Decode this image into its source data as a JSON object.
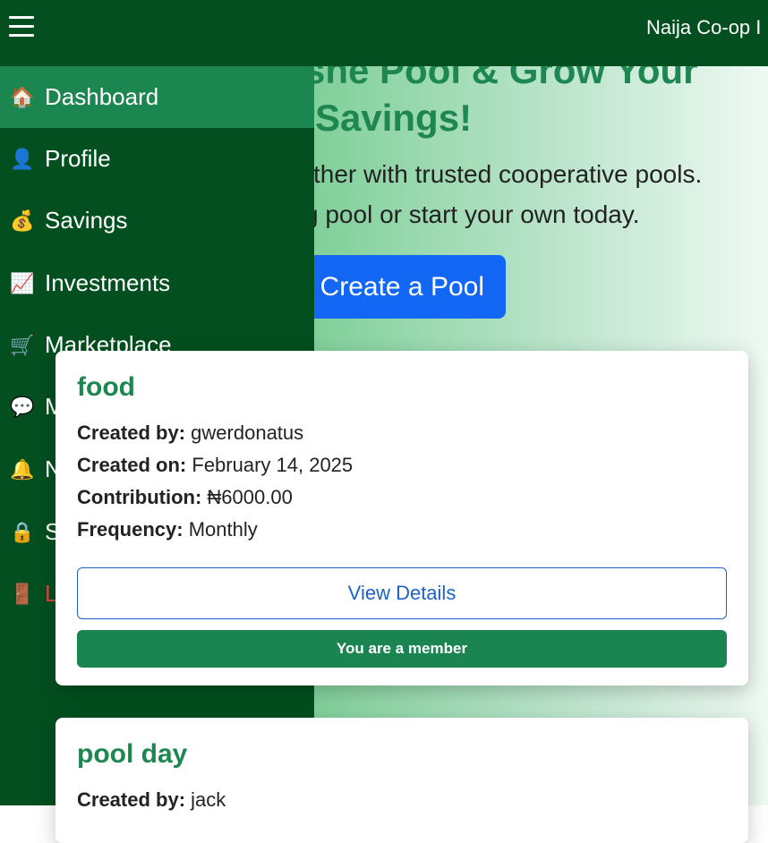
{
  "topbar": {
    "brand": "Naija Co-op I",
    "menu_icon": "hamburger-icon"
  },
  "hero": {
    "title": "she Pool & Grow Your Savings!",
    "title_line1": "she Pool & Grow Your",
    "title_line2": "Savings!",
    "subtitle_line1": "ther with trusted cooperative pools.",
    "subtitle_line2": "g pool or start your own today.",
    "create_button": "Create a Pool"
  },
  "sidebar": {
    "items": [
      {
        "icon": "🏠",
        "icon_name": "house-icon",
        "label": "Dashboard",
        "active": true
      },
      {
        "icon": "👤",
        "icon_name": "user-icon",
        "label": "Profile"
      },
      {
        "icon": "💰",
        "icon_name": "money-bag-icon",
        "label": "Savings"
      },
      {
        "icon": "📈",
        "icon_name": "chart-icon",
        "label": "Investments"
      },
      {
        "icon": "🛒",
        "icon_name": "cart-icon",
        "label": "Marketplace"
      },
      {
        "icon": "💬",
        "icon_name": "chat-icon",
        "label": "M"
      },
      {
        "icon": "🔔",
        "icon_name": "bell-icon",
        "label": "N"
      },
      {
        "icon": "🔒",
        "icon_name": "lock-icon",
        "label": "S"
      },
      {
        "icon": "🚪",
        "icon_name": "door-icon",
        "label": "L"
      }
    ]
  },
  "pools": [
    {
      "name": "food",
      "created_by_label": "Created by:",
      "created_by": "gwerdonatus",
      "created_on_label": "Created on:",
      "created_on": "February 14, 2025",
      "contribution_label": "Contribution:",
      "contribution": "₦6000.00",
      "frequency_label": "Frequency:",
      "frequency": "Monthly",
      "view_button": "View Details",
      "member_badge": "You are a member"
    },
    {
      "name": "pool day",
      "created_by_label": "Created by:",
      "created_by": "jack"
    }
  ]
}
